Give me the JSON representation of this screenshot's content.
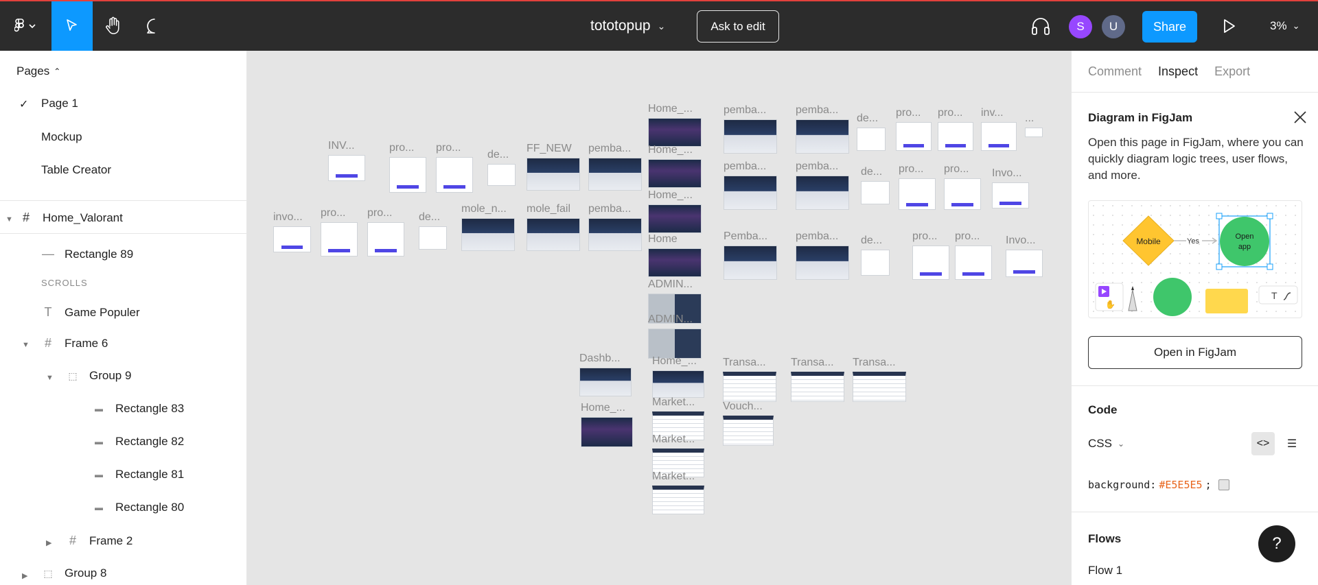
{
  "toolbar": {
    "file_title": "tototopup",
    "ask_to_edit": "Ask to edit",
    "avatars": [
      "S",
      "U"
    ],
    "share": "Share",
    "zoom": "3%"
  },
  "pages_panel": {
    "header": "Pages",
    "pages": [
      "Page 1",
      "Mockup",
      "Table Creator"
    ],
    "current_page": "Page 1"
  },
  "layers": {
    "frame": "Home_Valorant",
    "rect89": "Rectangle 89",
    "scrolls_label": "SCROLLS",
    "game_populer": "Game Populer",
    "frame6": "Frame 6",
    "group9": "Group 9",
    "rect83": "Rectangle 83",
    "rect82": "Rectangle 82",
    "rect81": "Rectangle 81",
    "rect80": "Rectangle 80",
    "frame2": "Frame 2",
    "group8": "Group 8"
  },
  "canvas": {
    "frames": [
      "INV...",
      "pro...",
      "pro...",
      "de...",
      "FF_NEW",
      "pemba...",
      "invo...",
      "pro...",
      "pro...",
      "de...",
      "mole_n...",
      "mole_fail",
      "pemba...",
      "Home_...",
      "Home_...",
      "Home_...",
      "Home",
      "ADMIN...",
      "ADMIN...",
      "pemba...",
      "pemba...",
      "pemba...",
      "pemba...",
      "Pemba...",
      "pemba...",
      "de...",
      "pro...",
      "pro...",
      "inv...",
      "...",
      "de...",
      "pro...",
      "pro...",
      "Invo...",
      "de...",
      "pro...",
      "pro...",
      "Invo...",
      "Dashb...",
      "Home_...",
      "Home_...",
      "Market...",
      "Market...",
      "Market...",
      "Transa...",
      "Transa...",
      "Transa...",
      "Vouch..."
    ]
  },
  "inspect": {
    "tabs": [
      "Comment",
      "Inspect",
      "Export"
    ],
    "active_tab": "Inspect",
    "card_title": "Diagram in FigJam",
    "card_desc": "Open this page in FigJam, where you can quickly diagram logic trees, user flows, and more.",
    "preview": {
      "node_mobile": "Mobile",
      "edge_yes": "Yes",
      "node_open": "Open app",
      "text_tool": "T"
    },
    "open_button": "Open in FigJam",
    "code_title": "Code",
    "code_lang": "CSS",
    "code_prop": "background:",
    "code_value": "#E5E5E5",
    "code_end": ";",
    "flows_title": "Flows",
    "flow_item": "Flow 1",
    "help": "?"
  },
  "colors": {
    "accent": "#0d99ff",
    "topbar": "#2c2c2c",
    "canvas": "#E5E5E5",
    "avatar_s": "#9747ff",
    "avatar_u": "#606a89"
  }
}
